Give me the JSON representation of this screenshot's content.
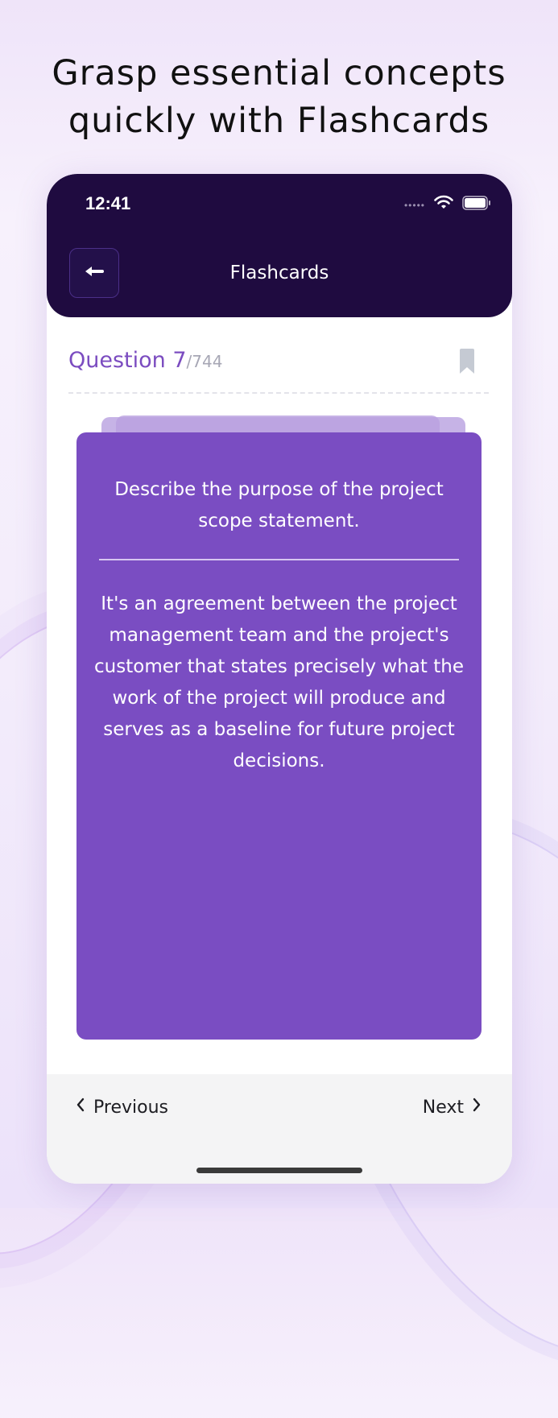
{
  "promo": {
    "headline_line1": "Grasp essential concepts",
    "headline_line2": "quickly with Flashcards"
  },
  "status_bar": {
    "time": "12:41"
  },
  "nav": {
    "title": "Flashcards",
    "back_icon": "arrow-left-icon"
  },
  "question": {
    "label": "Question 7",
    "total": "/744",
    "bookmark_icon": "bookmark-icon"
  },
  "card": {
    "question_text": "Describe the purpose of the project scope statement.",
    "answer_text": "It's an agreement between the project management team and the project's customer that states precisely what the work of the project will produce and serves as a baseline for future project decisions."
  },
  "footer": {
    "previous_label": "Previous",
    "next_label": "Next"
  },
  "colors": {
    "topbar": "#1f0b40",
    "card": "#7a4dc2",
    "accent": "#7b4cc0"
  }
}
